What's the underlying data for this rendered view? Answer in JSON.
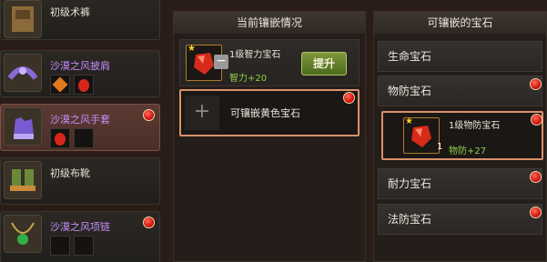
{
  "equipment": [
    {
      "name": "初级术裤",
      "quality": "white",
      "icon": "pants-icon"
    },
    {
      "name": "沙漠之风披肩",
      "quality": "purple",
      "icon": "shoulder-icon"
    },
    {
      "name": "沙漠之风手套",
      "quality": "purple",
      "icon": "gloves-icon"
    },
    {
      "name": "初级布靴",
      "quality": "white",
      "icon": "boots-icon"
    },
    {
      "name": "沙漠之风项链",
      "quality": "purple",
      "icon": "necklace-icon"
    }
  ],
  "current_inlay": {
    "title": "当前镶嵌情况",
    "socketed": {
      "name": "1级智力宝石",
      "stat": "智力+20"
    },
    "upgrade_label": "提升",
    "empty_slot_label": "可镶嵌黄色宝石"
  },
  "available_gems": {
    "title": "可镶嵌的宝石",
    "categories": [
      "生命宝石",
      "物防宝石",
      "耐力宝石",
      "法防宝石"
    ],
    "expanded_item": {
      "name": "1级物防宝石",
      "stat": "物防+27",
      "count": "1"
    }
  },
  "colors": {
    "accent_border": "#d7926a",
    "purple_text": "#c78dfc",
    "alert_red": "#d3140e"
  }
}
